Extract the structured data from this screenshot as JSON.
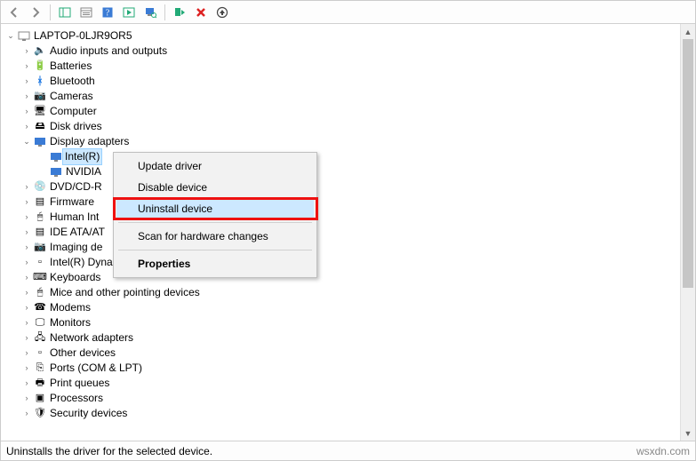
{
  "toolbar": {
    "back": "←",
    "forward": "→"
  },
  "root": {
    "name": "LAPTOP-0LJR9OR5"
  },
  "categories": [
    {
      "label": "Audio inputs and outputs",
      "icon": "🔈"
    },
    {
      "label": "Batteries",
      "icon": "🔋"
    },
    {
      "label": "Bluetooth",
      "icon": "ᛒ",
      "iconClass": "bt"
    },
    {
      "label": "Cameras",
      "icon": "📷"
    },
    {
      "label": "Computer",
      "icon": "🖥"
    },
    {
      "label": "Disk drives",
      "icon": "🖴"
    }
  ],
  "displayAdapters": {
    "label": "Display adapters",
    "children": [
      {
        "label": "Intel(R)",
        "selected": true
      },
      {
        "label": "NVIDIA"
      }
    ]
  },
  "afterCategories": [
    {
      "label": "DVD/CD-R",
      "icon": "💿",
      "clipped": true
    },
    {
      "label": "Firmware",
      "icon": "▤",
      "clipped": true
    },
    {
      "label": "Human Int",
      "icon": "🖱",
      "clipped": true,
      "trailingSpace": false
    },
    {
      "label": "IDE ATA/AT",
      "icon": "▤",
      "clipped": true
    },
    {
      "label": "Imaging de",
      "icon": "📷",
      "clipped": true
    }
  ],
  "restCategories": [
    {
      "label": "Intel(R) Dynamic Platform and Thermal Framework",
      "icon": "▫"
    },
    {
      "label": "Keyboards",
      "icon": "⌨"
    },
    {
      "label": "Mice and other pointing devices",
      "icon": "🖱"
    },
    {
      "label": "Modems",
      "icon": "☎"
    },
    {
      "label": "Monitors",
      "icon": "🖵"
    },
    {
      "label": "Network adapters",
      "icon": "🖧"
    },
    {
      "label": "Other devices",
      "icon": "▫"
    },
    {
      "label": "Ports (COM & LPT)",
      "icon": "⎘"
    },
    {
      "label": "Print queues",
      "icon": "🖶"
    },
    {
      "label": "Processors",
      "icon": "▣"
    },
    {
      "label": "Security devices",
      "icon": "🛡"
    }
  ],
  "contextMenu": {
    "items": [
      {
        "label": "Update driver",
        "kind": "item"
      },
      {
        "label": "Disable device",
        "kind": "item"
      },
      {
        "label": "Uninstall device",
        "kind": "item",
        "hover": true,
        "redbox": true
      },
      {
        "kind": "sep"
      },
      {
        "label": "Scan for hardware changes",
        "kind": "item"
      },
      {
        "kind": "sep"
      },
      {
        "label": "Properties",
        "kind": "item",
        "bold": true
      }
    ]
  },
  "status": {
    "text": "Uninstalls the driver for the selected device.",
    "watermark": "wsxdn.com"
  }
}
